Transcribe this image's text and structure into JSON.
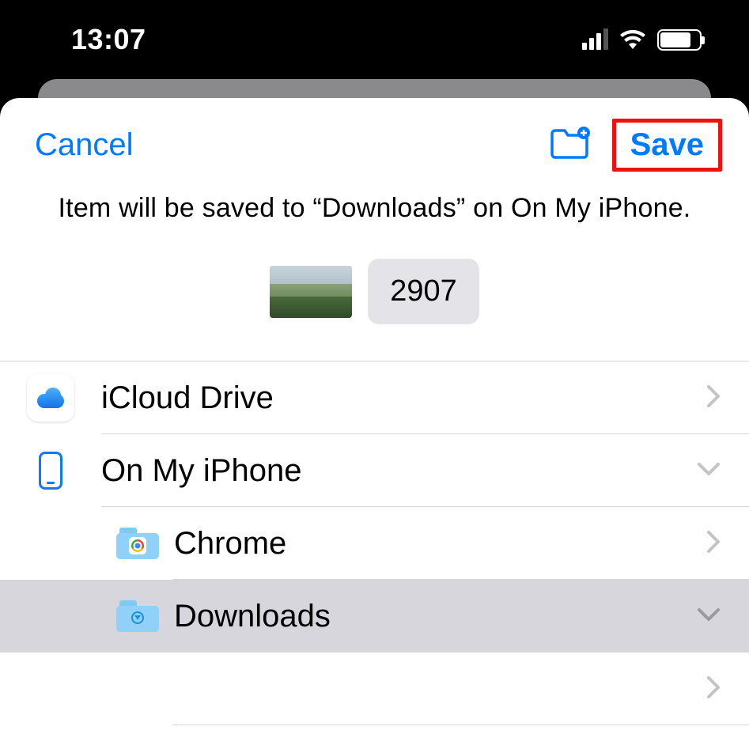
{
  "statusbar": {
    "time": "13:07"
  },
  "nav": {
    "cancel_label": "Cancel",
    "save_label": "Save"
  },
  "info_text": "Item will be saved to “Downloads” on On My iPhone.",
  "item": {
    "filename": "2907"
  },
  "locations": [
    {
      "label": "iCloud Drive"
    },
    {
      "label": "On My iPhone"
    },
    {
      "label": "Chrome"
    },
    {
      "label": "Downloads"
    }
  ],
  "highlight": {
    "target": "save-button"
  }
}
